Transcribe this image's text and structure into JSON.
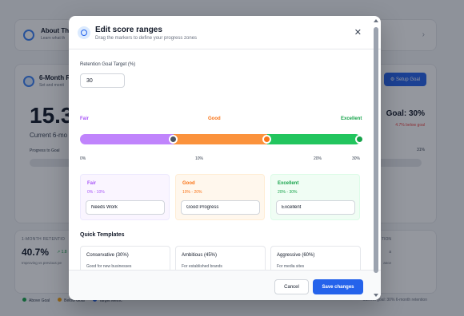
{
  "background": {
    "about": {
      "title": "About Thi",
      "subtitle": "Learn what th"
    },
    "main": {
      "title": "6-Month R",
      "subtitle": "Set and monit",
      "big_value": "15.3",
      "caption": "Current 6-mo",
      "progress_label": "Progress to Goal",
      "setup_button": "Setup Goal",
      "goal_text": "Goal: 30%",
      "below_text": "4.7% below goal",
      "goal_pct": "31%"
    },
    "bottom": {
      "label": "1-MONTH RETENTIO",
      "value": "40.7%",
      "increase": "↗ 1.8",
      "note": "Improving vs previous pe",
      "right_label": "TION",
      "right_mid": "a",
      "right_note": "ance"
    },
    "legend": [
      {
        "label": "Above Goal",
        "color": "#16a34a"
      },
      {
        "label": "Below Goal",
        "color": "#f59e0b"
      },
      {
        "label": "Target Metric",
        "color": "#2563eb"
      }
    ],
    "legend_right": "Current goal: 30% 6-month retention"
  },
  "modal": {
    "title": "Edit score ranges",
    "subtitle": "Drag the markers to define your progress zones",
    "retention_label": "Retention Goal Target (%)",
    "retention_value": "30",
    "zones": [
      {
        "name": "Fair",
        "color": "#a855f7",
        "bar_color": "#c084fc",
        "range": "0% - 10%",
        "label_value": "Needs Work",
        "bg": "#faf5ff",
        "border": "#ede9fe"
      },
      {
        "name": "Good",
        "color": "#f97316",
        "bar_color": "#fb923c",
        "range": "10% - 20%",
        "label_value": "Good Progress",
        "bg": "#fff7ed",
        "border": "#ffedd5"
      },
      {
        "name": "Excellent",
        "color": "#16a34a",
        "bar_color": "#22c55e",
        "range": "20% - 30%",
        "label_value": "Excellent",
        "bg": "#f0fdf4",
        "border": "#dcfce7"
      }
    ],
    "ticks": [
      "0%",
      "10%",
      "20%",
      "30%"
    ],
    "quick_templates_title": "Quick Templates",
    "templates": [
      {
        "name": "Conservative (30%)",
        "desc": "Good for new businesses"
      },
      {
        "name": "Ambitious (45%)",
        "desc": "For established brands"
      },
      {
        "name": "Aggressive (60%)",
        "desc": "For media sites"
      }
    ],
    "cancel_label": "Cancel",
    "save_label": "Save changes"
  }
}
